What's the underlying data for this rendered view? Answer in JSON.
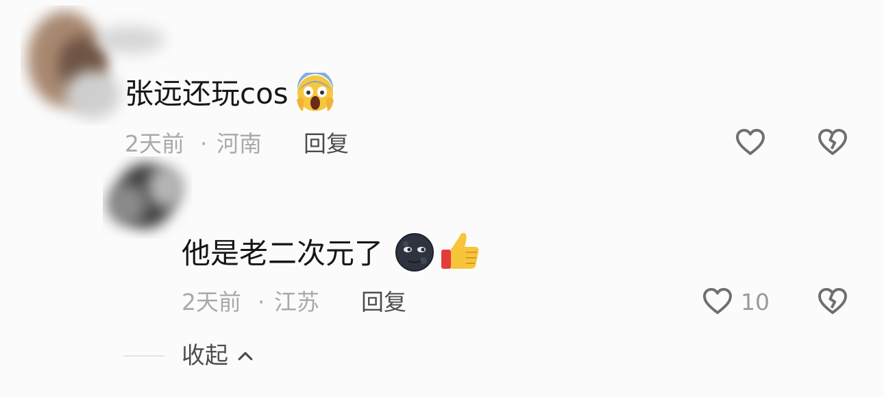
{
  "comments": [
    {
      "text": "张远还玩cos",
      "emoji_icons": [
        "face-screaming-in-fear-icon"
      ],
      "time": "2天前",
      "separator": "·",
      "location": "河南",
      "reply_label": "回复",
      "like_count": ""
    },
    {
      "text": "他是老二次元了",
      "emoji_icons": [
        "new-moon-face-icon",
        "thumbs-up-icon"
      ],
      "time": "2天前",
      "separator": "·",
      "location": "江苏",
      "reply_label": "回复",
      "like_count": "10"
    }
  ],
  "collapse_label": "收起",
  "icons": {
    "like": "heart-outline-icon",
    "dislike": "broken-heart-icon",
    "collapse": "chevron-up-icon"
  },
  "colors": {
    "text": "#161616",
    "meta": "#a9a9a9",
    "icon": "#6f6f6f"
  }
}
